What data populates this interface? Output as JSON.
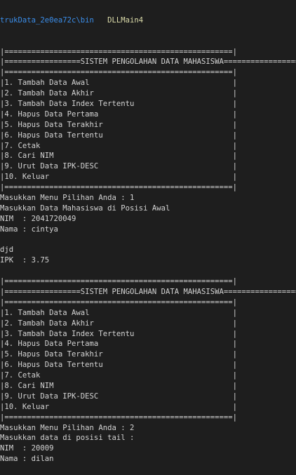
{
  "terminal": {
    "prompt_path": "trukData_2e0ea72c\\bin",
    "prompt_cmd": "DLLMain4",
    "lines": [
      "|===================================================|",
      "|=================SISTEM PENGOLAHAN DATA MAHASISWA=================|",
      "|===================================================|",
      "|1. Tambah Data Awal                                |",
      "|2. Tambah Data Akhir                               |",
      "|3. Tambah Data Index Tertentu                      |",
      "|4. Hapus Data Pertama                              |",
      "|5. Hapus Data Terakhir                             |",
      "|6. Hapus Data Tertentu                             |",
      "|7. Cetak                                           |",
      "|8. Cari NIM                                        |",
      "|9. Urut Data IPK-DESC                              |",
      "|10. Keluar                                         |",
      "|===================================================|",
      "Masukkan Menu Pilihan Anda : 1",
      "Masukkan Data Mahasiswa di Posisi Awal",
      "NIM  : 2041720049",
      "Nama : cintya",
      "",
      "djd",
      "IPK  : 3.75",
      "",
      "|===================================================|",
      "|=================SISTEM PENGOLAHAN DATA MAHASISWA=================|",
      "|===================================================|",
      "|1. Tambah Data Awal                                |",
      "|2. Tambah Data Akhir                               |",
      "|3. Tambah Data Index Tertentu                      |",
      "|4. Hapus Data Pertama                              |",
      "|5. Hapus Data Terakhir                             |",
      "|6. Hapus Data Tertentu                             |",
      "|7. Cetak                                           |",
      "|8. Cari NIM                                        |",
      "|9. Urut Data IPK-DESC                              |",
      "|10. Keluar                                         |",
      "|===================================================|",
      "Masukkan Menu Pilihan Anda : 2",
      "Masukkan data di posisi tail :",
      "NIM  : 20009",
      "Nama : dilan"
    ]
  },
  "colors": {
    "background": "#1e1e1e",
    "text": "#d4d4d4",
    "path": "#3b8eea",
    "command": "#dcdcaa"
  }
}
